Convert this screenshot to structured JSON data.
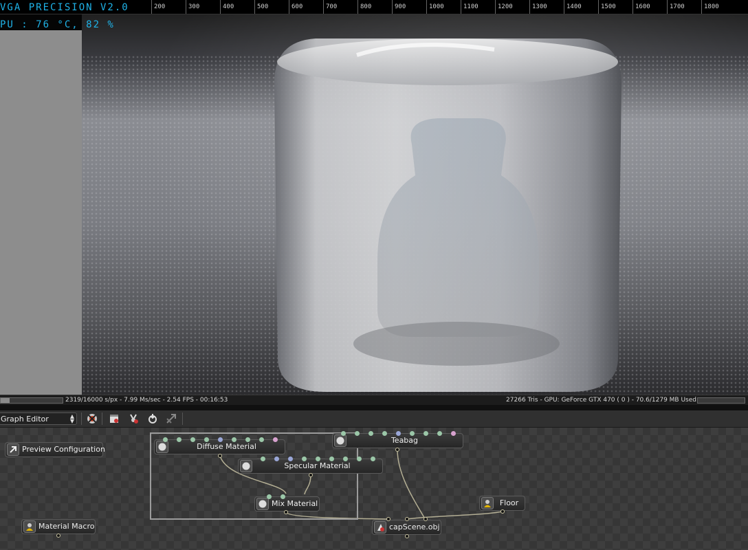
{
  "hud": {
    "title": "VGA PRECISION V2.0",
    "temp": "PU : 76 °C, 82 %"
  },
  "ruler_ticks": [
    "200",
    "300",
    "400",
    "500",
    "600",
    "700",
    "800",
    "900",
    "1000",
    "1100",
    "1200",
    "1300",
    "1400",
    "1500",
    "1600",
    "1700",
    "1800"
  ],
  "status": {
    "left": "2319/16000 s/px - 7.99 Ms/sec - 2.54 FPS - 00:16:53",
    "right": "27266 Tris - GPU: GeForce GTX 470 ( 0 ) - 70.6/1279 MB Used",
    "progress_fraction": 0.145
  },
  "toolbar": {
    "editor": "Graph Editor",
    "buttons": [
      "delete-node-icon",
      "render-clapper-icon",
      "add-lamp-icon",
      "import-icon",
      "export-icon"
    ]
  },
  "nodes": {
    "preview": "Preview Configuration",
    "diffuse": "Diffuse Material",
    "specular": "Specular Material",
    "mix": "Mix Material",
    "teabag": "Teabag",
    "floor": "Floor",
    "macro": "Material Macro",
    "scene": "capScene.obj"
  },
  "colors": {
    "hud": "#1fb3e8",
    "pin_green": "#9bc7a8",
    "pin_blue": "#9aa7d8",
    "pin_pink": "#d8a2cf",
    "wire": "#c9c3a4"
  }
}
